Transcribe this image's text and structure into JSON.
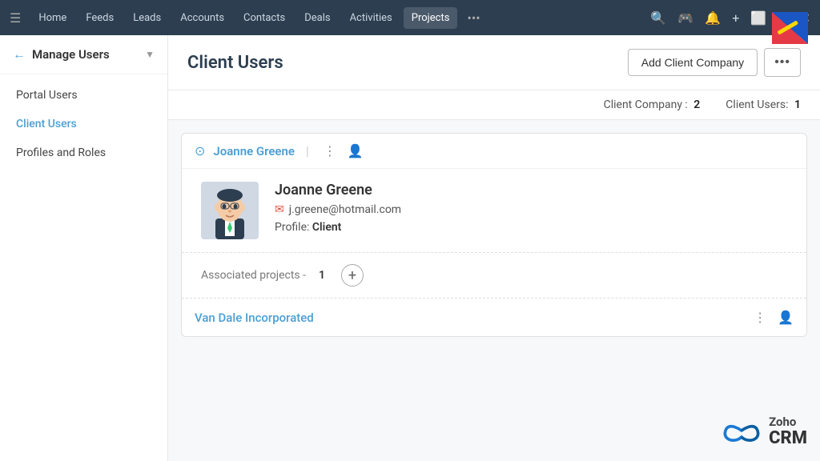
{
  "toplogo": {
    "alt": "Zoho Logo"
  },
  "navbar": {
    "hamburger": "☰",
    "items": [
      {
        "label": "Home",
        "active": false
      },
      {
        "label": "Feeds",
        "active": false
      },
      {
        "label": "Leads",
        "active": false
      },
      {
        "label": "Accounts",
        "active": false
      },
      {
        "label": "Contacts",
        "active": false
      },
      {
        "label": "Deals",
        "active": false
      },
      {
        "label": "Activities",
        "active": false
      },
      {
        "label": "Projects",
        "active": true
      }
    ],
    "dots": "•••",
    "icons": [
      "🔍",
      "🎮",
      "🔔",
      "+",
      "⬜",
      "✉",
      "✕"
    ]
  },
  "sidebar": {
    "back_icon": "←",
    "title": "Manage Users",
    "chevron": "▼",
    "items": [
      {
        "label": "Portal Users",
        "active": false
      },
      {
        "label": "Client Users",
        "active": true
      },
      {
        "label": "Profiles and Roles",
        "active": false
      }
    ]
  },
  "page": {
    "title": "Client Users",
    "add_button": "Add Client Company",
    "more_button": "•••",
    "stats": {
      "company_label": "Client Company :",
      "company_count": "2",
      "users_label": "Client Users:",
      "users_count": "1"
    }
  },
  "user": {
    "name": "Joanne Greene",
    "email": "j.greene@hotmail.com",
    "profile_label": "Profile:",
    "profile_value": "Client",
    "associated_label": "Associated projects -",
    "associated_count": "1"
  },
  "company": {
    "name": "Van Dale Incorporated"
  },
  "zoho": {
    "infinity": "♾",
    "name": "Zoho",
    "crm": "CRM"
  }
}
